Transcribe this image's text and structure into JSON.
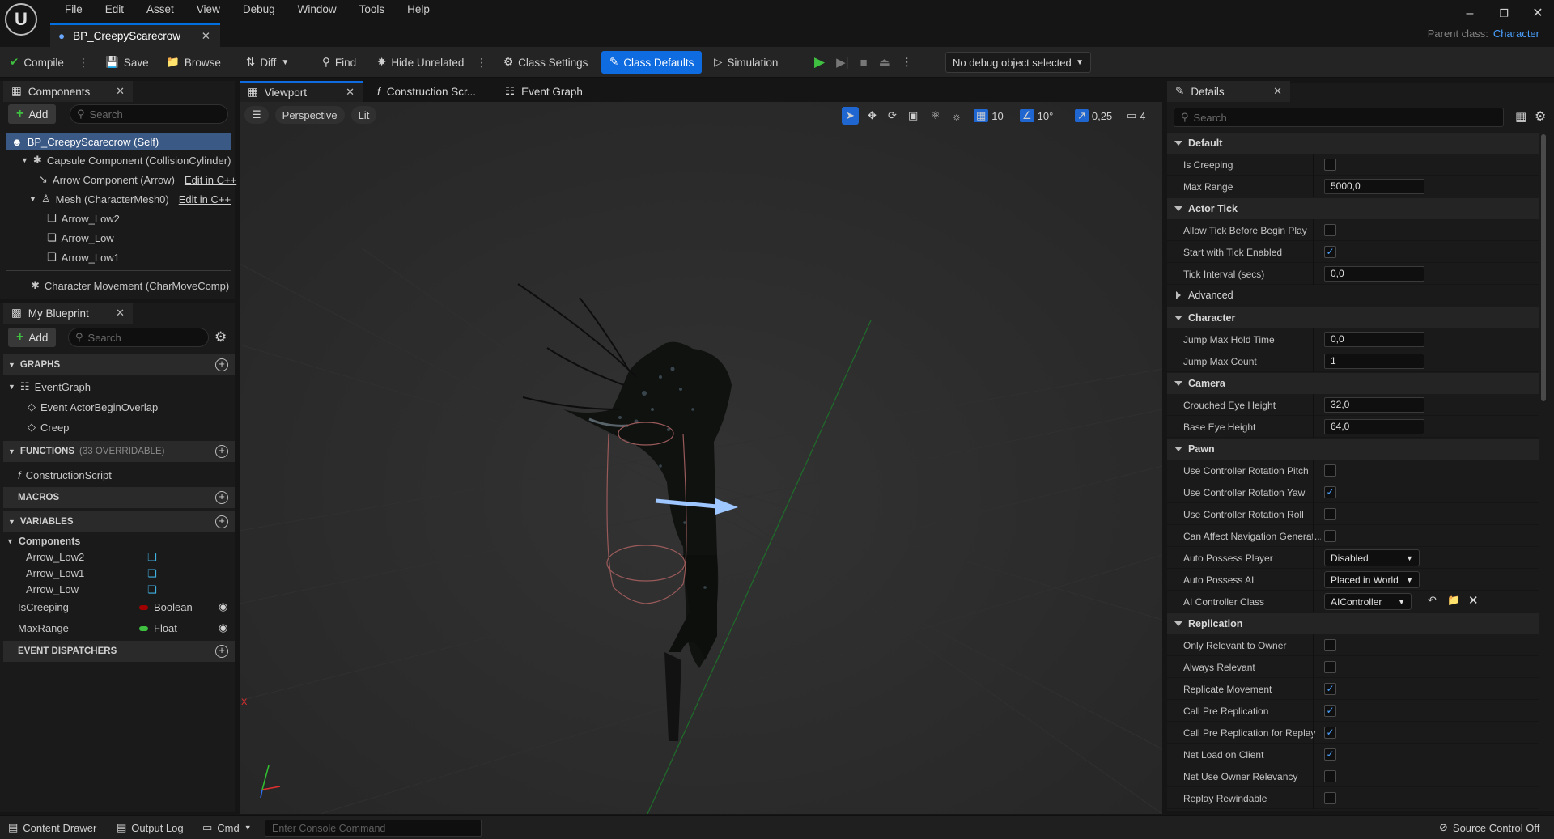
{
  "menu": [
    "File",
    "Edit",
    "View",
    "Debug",
    "Window",
    "Tools",
    "Help",
    "Asset"
  ],
  "menu_items": [
    "File",
    "Edit",
    "Asset",
    "View",
    "Debug",
    "Window",
    "Tools",
    "Help"
  ],
  "document_tab": {
    "title": "BP_CreepyScarecrow"
  },
  "parent_class": {
    "label": "Parent class:",
    "value": "Character"
  },
  "toolbar": {
    "compile": "Compile",
    "save": "Save",
    "browse": "Browse",
    "diff": "Diff",
    "find": "Find",
    "hide_unrelated": "Hide Unrelated",
    "class_settings": "Class Settings",
    "class_defaults": "Class Defaults",
    "simulation": "Simulation",
    "debug_object": "No debug object selected"
  },
  "components_panel": {
    "title": "Components",
    "add": "Add",
    "search_placeholder": "Search",
    "items": [
      "BP_CreepyScarecrow (Self)",
      "Capsule Component (CollisionCylinder)",
      "Arrow Component (Arrow)",
      "Mesh (CharacterMesh0)",
      "Arrow_Low2",
      "Arrow_Low",
      "Arrow_Low1",
      "Character Movement (CharMoveComp)"
    ],
    "edit_cpp": "Edit in C++"
  },
  "my_blueprint": {
    "title": "My Blueprint",
    "add": "Add",
    "search_placeholder": "Search",
    "graphs_header": "GRAPHS",
    "event_graph": "EventGraph",
    "event_overlap": "Event ActorBeginOverlap",
    "event_creep": "Creep",
    "functions_header": "FUNCTIONS",
    "functions_count": "(33 OVERRIDABLE)",
    "construction_script": "ConstructionScript",
    "macros_header": "MACROS",
    "variables_header": "VARIABLES",
    "components_group": "Components",
    "component_vars": [
      "Arrow_Low2",
      "Arrow_Low1",
      "Arrow_Low"
    ],
    "var_is_creeping": "IsCreeping",
    "var_is_creeping_type": "Boolean",
    "var_max_range": "MaxRange",
    "var_max_range_type": "Float",
    "dispatchers_header": "EVENT DISPATCHERS"
  },
  "editor_tabs": {
    "viewport": "Viewport",
    "construction": "Construction Scr...",
    "event_graph": "Event Graph"
  },
  "viewport": {
    "perspective": "Perspective",
    "lit": "Lit",
    "grid_snap": "10",
    "rot_snap": "10°",
    "scale_snap": "0,25",
    "cam_speed": "4"
  },
  "details": {
    "title": "Details",
    "search_placeholder": "Search",
    "sections": {
      "default": "Default",
      "actor_tick": "Actor Tick",
      "advanced": "Advanced",
      "character": "Character",
      "camera": "Camera",
      "pawn": "Pawn",
      "replication": "Replication"
    },
    "props": {
      "is_creeping": "Is Creeping",
      "max_range": "Max Range",
      "max_range_val": "5000,0",
      "allow_tick": "Allow Tick Before Begin Play",
      "start_tick": "Start with Tick Enabled",
      "tick_interval": "Tick Interval (secs)",
      "tick_interval_val": "0,0",
      "jump_hold": "Jump Max Hold Time",
      "jump_hold_val": "0,0",
      "jump_count": "Jump Max Count",
      "jump_count_val": "1",
      "crouched_eye": "Crouched Eye Height",
      "crouched_eye_val": "32,0",
      "base_eye": "Base Eye Height",
      "base_eye_val": "64,0",
      "ucr_pitch": "Use Controller Rotation Pitch",
      "ucr_yaw": "Use Controller Rotation Yaw",
      "ucr_roll": "Use Controller Rotation Roll",
      "can_affect_nav": "Can Affect Navigation Generat...",
      "auto_possess_player": "Auto Possess Player",
      "auto_possess_player_val": "Disabled",
      "auto_possess_ai": "Auto Possess AI",
      "auto_possess_ai_val": "Placed in World",
      "ai_controller": "AI Controller Class",
      "ai_controller_val": "AIController",
      "only_relevant_owner": "Only Relevant to Owner",
      "always_relevant": "Always Relevant",
      "replicate_movement": "Replicate Movement",
      "call_pre_rep": "Call Pre Replication",
      "call_pre_rep_replay": "Call Pre Replication for Replay",
      "net_load_client": "Net Load on Client",
      "net_use_owner": "Net Use Owner Relevancy",
      "replay_rewindable": "Replay Rewindable"
    }
  },
  "statusbar": {
    "content_drawer": "Content Drawer",
    "output_log": "Output Log",
    "cmd": "Cmd",
    "console_placeholder": "Enter Console Command",
    "source_control": "Source Control Off"
  },
  "colors": {
    "accent": "#0e6be0",
    "bool_pin": "#a00000",
    "float_pin": "#3fc040",
    "link": "#4aa0ff"
  }
}
